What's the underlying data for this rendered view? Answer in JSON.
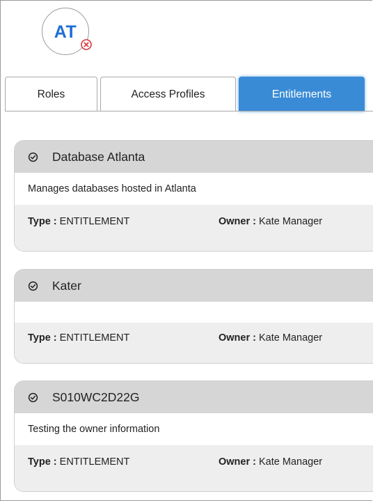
{
  "user": {
    "initials": "AT",
    "remove_icon": "close-circle-icon",
    "remove_color": "#d9363e",
    "initials_color": "#1f6ed4"
  },
  "tabs": [
    {
      "label": "Roles",
      "active": false
    },
    {
      "label": "Access Profiles",
      "active": false
    },
    {
      "label": "Entitlements",
      "active": true
    }
  ],
  "accent_color": "#3a8bd6",
  "entitlements": [
    {
      "icon": "check-circle-icon",
      "name": "Database Atlanta",
      "description": "Manages databases hosted in Atlanta",
      "type_label": "Type :",
      "type_value": "ENTITLEMENT",
      "owner_label": "Owner :",
      "owner_value": "Kate Manager"
    },
    {
      "icon": "check-circle-icon",
      "name": "Kater",
      "description": "",
      "type_label": "Type :",
      "type_value": "ENTITLEMENT",
      "owner_label": "Owner :",
      "owner_value": "Kate Manager"
    },
    {
      "icon": "check-circle-icon",
      "name": "S010WC2D22G",
      "description": "Testing the owner information",
      "type_label": "Type :",
      "type_value": "ENTITLEMENT",
      "owner_label": "Owner :",
      "owner_value": "Kate Manager"
    }
  ]
}
